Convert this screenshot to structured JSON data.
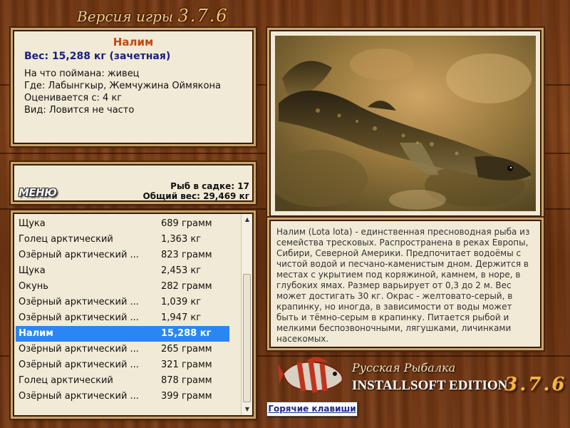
{
  "app": {
    "title_prefix": "Версия игры",
    "version": "3.7.6"
  },
  "catch_info": {
    "name": "Налим",
    "weight": "Вес: 15,288 кг (зачетная)",
    "lines": [
      "На что поймана: живец",
      "Где: Лабынгкыр, Жемчужина Оймякона",
      "Оценивается с: 4 кг",
      "Вид: Ловится не часто"
    ]
  },
  "stats": {
    "menu_label": "МЕНЮ",
    "fish_in_keepnet": "Рыб в садке: 17",
    "total_weight": "Общий вес: 29,469 кг"
  },
  "fish_list": [
    {
      "name": "Щука",
      "weight": "689 грамм"
    },
    {
      "name": "Голец арктический",
      "weight": "1,363 кг"
    },
    {
      "name": "Озёрный арктический ...",
      "weight": "823 грамм"
    },
    {
      "name": "Щука",
      "weight": "2,453 кг"
    },
    {
      "name": "Окунь",
      "weight": "282 грамм"
    },
    {
      "name": "Озёрный арктический ...",
      "weight": "1,039 кг"
    },
    {
      "name": "Озёрный арктический ...",
      "weight": "1,947 кг"
    },
    {
      "name": "Налим",
      "weight": "15,288 кг"
    },
    {
      "name": "Озёрный арктический ...",
      "weight": "265 грамм"
    },
    {
      "name": "Озёрный арктический ...",
      "weight": "321 грамм"
    },
    {
      "name": "Голец арктический",
      "weight": "878 грамм"
    },
    {
      "name": "Озёрный арктический ...",
      "weight": "399 грамм"
    }
  ],
  "selected_index": 7,
  "description": "Налим (Lota lota) - единственная пресноводная рыба из семейства тресковых. Распространена в реках Европы, Сибири, Северной Америки. Предпочитает водоёмы с чистой водой и песчано-каменистым дном. Держится в местах с укрытием под коряжиной, камнем, в норе, в глубоких ямах. Размер варьирует от 0,3 до 2 м. Вес может достигать 30 кг. Окрас - желтовато-серый, в крапинку, но иногда, в зависимости от воды может быть и тёмно-серым в крапинку. Питается рыбой и мелкими беспозвоночными, лягушками, личинками насекомых.",
  "logo": {
    "line1": "Русская Рыбалка",
    "line2": "INSTALLSOFT EDITION",
    "version": "3.7.6"
  },
  "hotkeys_label": "Горячие клавиши",
  "colors": {
    "selection": "#2b86f5",
    "fish_name": "#c04a10",
    "weight": "#1b1f7a",
    "version": "#f5b742"
  }
}
